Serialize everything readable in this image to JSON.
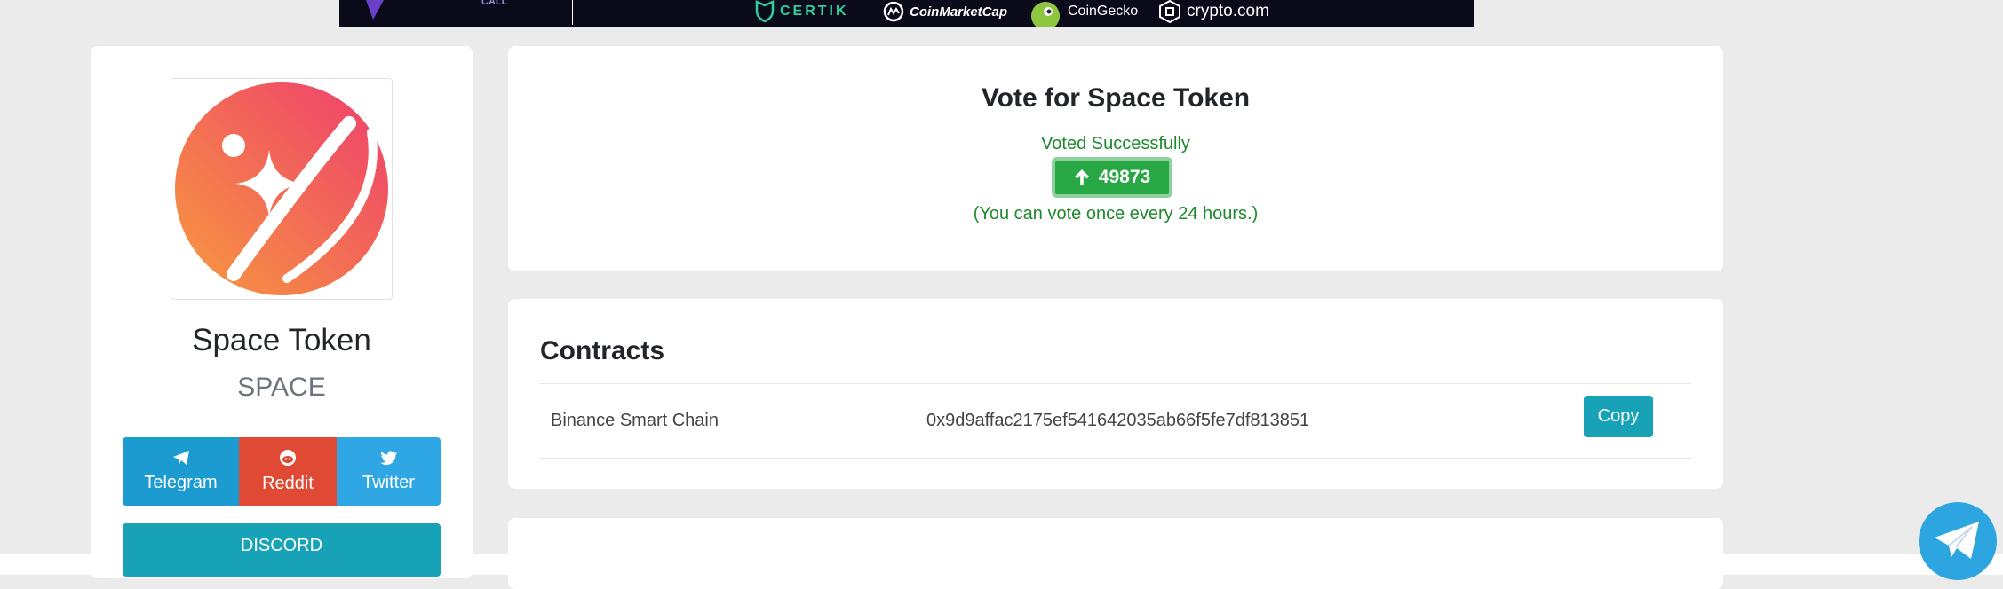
{
  "banner": {
    "partner_small_text": "CALL",
    "partners": [
      "CERTIK",
      "CoinMarketCap",
      "CoinGecko",
      "crypto.com"
    ]
  },
  "coin": {
    "name": "Space Token",
    "symbol": "SPACE",
    "logo_colors": {
      "start": "#f79a3e",
      "end": "#ee3d6e"
    }
  },
  "social": {
    "telegram_label": "Telegram",
    "reddit_label": "Reddit",
    "twitter_label": "Twitter",
    "discord_label": "DISCORD"
  },
  "vote": {
    "title": "Vote for Space Token",
    "status": "Voted Successfully",
    "count": "49873",
    "note": "(You can vote once every 24 hours.)"
  },
  "contracts": {
    "title": "Contracts",
    "rows": [
      {
        "chain": "Binance Smart Chain",
        "address": "0x9d9affac2175ef541642035ab66f5fe7df813851",
        "copy_label": "Copy"
      }
    ]
  },
  "colors": {
    "page_bg": "#ebebeb",
    "success_green": "#28a745",
    "info_teal": "#17a2b8",
    "telegram_blue": "#1b9bd0",
    "reddit_red": "#e04a34",
    "twitter_blue": "#2fa7e4"
  },
  "icons": {
    "vote_arrow": "arrow-up-icon",
    "floating": "telegram-icon"
  }
}
